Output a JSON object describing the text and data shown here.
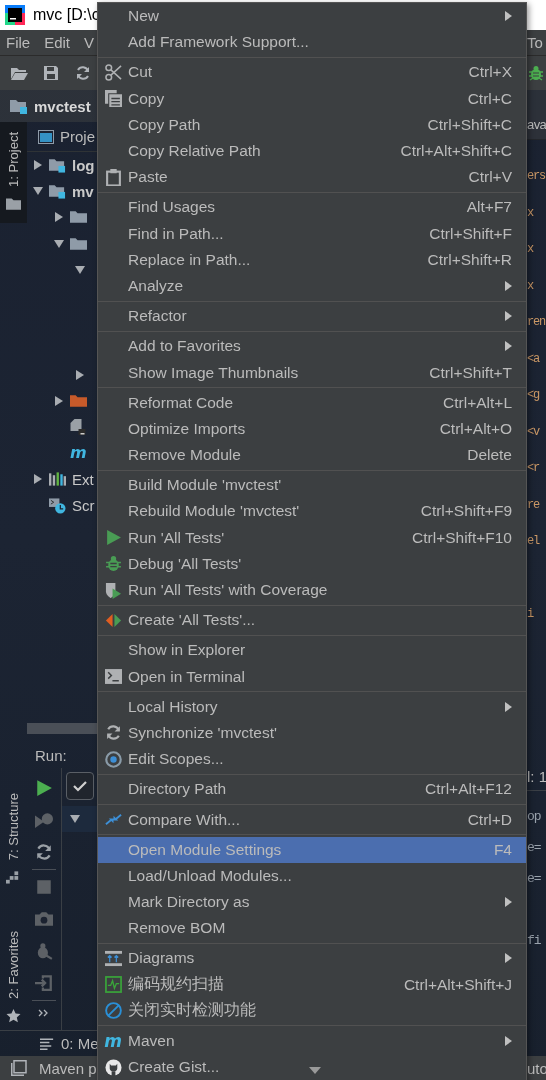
{
  "window": {
    "title": "mvc [D:\\c"
  },
  "menu_bar": {
    "items": [
      "File",
      "Edit",
      "V"
    ],
    "edge_item": "To"
  },
  "project_header": {
    "title": "mvctest"
  },
  "tool_stripe": [
    {
      "label": "1: Project",
      "selected": true
    },
    {
      "label": "7: Structure",
      "selected": false
    },
    {
      "label": "2: Favorites",
      "selected": false
    }
  ],
  "project_view": {
    "tab": "Proje"
  },
  "project_tree": [
    {
      "label": "log",
      "kind": "module",
      "expanded": false
    },
    {
      "label": "mv",
      "kind": "module",
      "expanded": true,
      "children": [
        {
          "kind": "folder",
          "expanded": false
        },
        {
          "kind": "folder",
          "expanded": true,
          "children": [
            {
              "expanded": true
            },
            {
              "expanded": false
            }
          ]
        },
        {
          "kind": "excluded-folder",
          "expanded": false
        },
        {
          "kind": "file"
        },
        {
          "kind": "maven-file",
          "icon_text": "m"
        }
      ]
    },
    {
      "label": "Ext",
      "kind": "libraries",
      "expanded": false
    },
    {
      "label": "Scr",
      "kind": "scratches"
    }
  ],
  "editor": {
    "tab": "ava",
    "lines": [
      {
        "text": "ers"
      },
      {
        "text": "x"
      },
      {
        "text": "x"
      },
      {
        "text": "x"
      },
      {
        "text": "ren"
      },
      {
        "text": "<a"
      },
      {
        "text": "<g"
      },
      {
        "text": "<v"
      },
      {
        "text": "<r"
      },
      {
        "text": "re"
      },
      {
        "text": "el"
      },
      {
        "text": "i"
      }
    ]
  },
  "run_panel": {
    "title": "Run:",
    "passed_toggle": {
      "on": true
    },
    "test_tree": [
      {
        "expanded": true,
        "selected": true
      }
    ],
    "header_text": "l: 1",
    "console_lines": [
      {
        "text": "op"
      },
      {
        "text": "e="
      },
      {
        "text": "e="
      },
      {
        "text": "fi"
      }
    ]
  },
  "bottom_tabs": [
    "0: Me"
  ],
  "status_bar": {
    "text": "Maven p",
    "edge_text": "uto"
  },
  "context_menu": {
    "groups": [
      [
        {
          "label": "New",
          "submenu": true,
          "selected": false
        },
        {
          "label": "Add Framework Support...",
          "submenu": false,
          "selected": false
        }
      ],
      [
        {
          "label": "Cut",
          "shortcut": "Ctrl+X",
          "submenu": false,
          "selected": false
        },
        {
          "label": "Copy",
          "shortcut": "Ctrl+C",
          "submenu": false,
          "selected": false
        },
        {
          "label": "Copy Path",
          "shortcut": "Ctrl+Shift+C",
          "submenu": false,
          "selected": false
        },
        {
          "label": "Copy Relative Path",
          "shortcut": "Ctrl+Alt+Shift+C",
          "submenu": false,
          "selected": false
        },
        {
          "label": "Paste",
          "shortcut": "Ctrl+V",
          "submenu": false,
          "selected": false
        }
      ],
      [
        {
          "label": "Find Usages",
          "shortcut": "Alt+F7",
          "submenu": false,
          "selected": false
        },
        {
          "label": "Find in Path...",
          "shortcut": "Ctrl+Shift+F",
          "submenu": false,
          "selected": false
        },
        {
          "label": "Replace in Path...",
          "shortcut": "Ctrl+Shift+R",
          "submenu": false,
          "selected": false
        },
        {
          "label": "Analyze",
          "submenu": true,
          "selected": false
        }
      ],
      [
        {
          "label": "Refactor",
          "submenu": true,
          "selected": false
        }
      ],
      [
        {
          "label": "Add to Favorites",
          "submenu": true,
          "selected": false
        },
        {
          "label": "Show Image Thumbnails",
          "shortcut": "Ctrl+Shift+T",
          "submenu": false,
          "selected": false
        }
      ],
      [
        {
          "label": "Reformat Code",
          "shortcut": "Ctrl+Alt+L",
          "submenu": false,
          "selected": false
        },
        {
          "label": "Optimize Imports",
          "shortcut": "Ctrl+Alt+O",
          "submenu": false,
          "selected": false
        },
        {
          "label": "Remove Module",
          "shortcut": "Delete",
          "submenu": false,
          "selected": false
        }
      ],
      [
        {
          "label": "Build Module 'mvctest'",
          "submenu": false,
          "selected": false
        },
        {
          "label": "Rebuild Module 'mvctest'",
          "shortcut": "Ctrl+Shift+F9",
          "submenu": false,
          "selected": false
        },
        {
          "label": "Run 'All Tests'",
          "shortcut": "Ctrl+Shift+F10",
          "submenu": false,
          "selected": false
        },
        {
          "label": "Debug 'All Tests'",
          "submenu": false,
          "selected": false
        },
        {
          "label": "Run 'All Tests' with Coverage",
          "submenu": false,
          "selected": false
        }
      ],
      [
        {
          "label": "Create 'All Tests'...",
          "submenu": false,
          "selected": false
        }
      ],
      [
        {
          "label": "Show in Explorer",
          "submenu": false,
          "selected": false
        },
        {
          "label": "Open in Terminal",
          "submenu": false,
          "selected": false
        }
      ],
      [
        {
          "label": "Local History",
          "submenu": true,
          "selected": false
        },
        {
          "label": "Synchronize 'mvctest'",
          "submenu": false,
          "selected": false
        },
        {
          "label": "Edit Scopes...",
          "submenu": false,
          "selected": false
        }
      ],
      [
        {
          "label": "Directory Path",
          "shortcut": "Ctrl+Alt+F12",
          "submenu": false,
          "selected": false
        }
      ],
      [
        {
          "label": "Compare With...",
          "shortcut": "Ctrl+D",
          "submenu": false,
          "selected": false
        }
      ],
      [
        {
          "label": "Open Module Settings",
          "shortcut": "F4",
          "submenu": false,
          "selected": true
        },
        {
          "label": "Load/Unload Modules...",
          "submenu": false,
          "selected": false
        },
        {
          "label": "Mark Directory as",
          "submenu": true,
          "selected": false
        },
        {
          "label": "Remove BOM",
          "submenu": false,
          "selected": false
        }
      ],
      [
        {
          "label": "Diagrams",
          "submenu": true,
          "selected": false
        },
        {
          "label": "编码规约扫描",
          "shortcut": "Ctrl+Alt+Shift+J",
          "submenu": false,
          "selected": false
        },
        {
          "label": "关闭实时检测功能",
          "submenu": false,
          "selected": false
        }
      ],
      [
        {
          "label": "Maven",
          "icon_text": "m",
          "submenu": true,
          "selected": false
        },
        {
          "label": "Create Gist...",
          "submenu": false,
          "selected": false
        }
      ]
    ]
  }
}
